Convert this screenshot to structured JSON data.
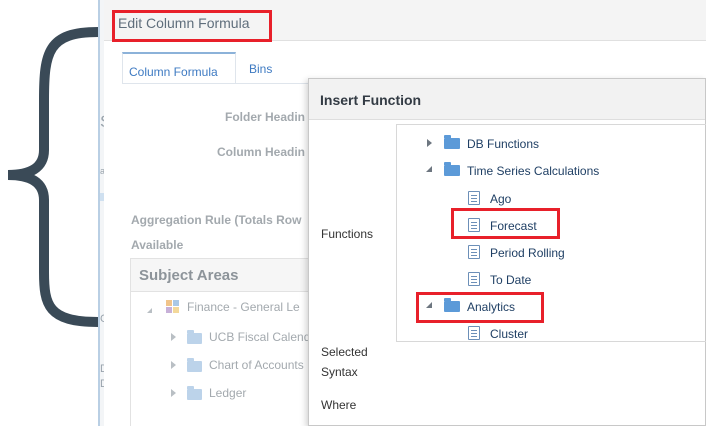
{
  "dialog": {
    "title": "Edit Column Formula",
    "tabs": [
      {
        "label": "Column Formula"
      },
      {
        "label": "Bins"
      }
    ],
    "labels": {
      "folder_heading": "Folder Headin",
      "column_heading": "Column Headin",
      "aggregation_rule": "Aggregation Rule (Totals Row",
      "available": "Available"
    },
    "subject_areas": {
      "header": "Subject Areas",
      "items": [
        {
          "label": "Finance - General Le"
        },
        {
          "label": "UCB Fiscal Calend"
        },
        {
          "label": "Chart of Accounts"
        },
        {
          "label": "Ledger"
        }
      ]
    },
    "bg_chars": [
      "S",
      "ac",
      "C",
      "D",
      "D"
    ]
  },
  "insert_function": {
    "title": "Insert Function",
    "labels": {
      "functions": "Functions",
      "selected": "Selected",
      "syntax": "Syntax",
      "where": "Where"
    },
    "tree": [
      {
        "label": "DB Functions",
        "kind": "folder",
        "state": "collapsed"
      },
      {
        "label": "Time Series Calculations",
        "kind": "folder",
        "state": "expanded"
      },
      {
        "label": "Ago",
        "kind": "function"
      },
      {
        "label": "Forecast",
        "kind": "function",
        "highlighted": true
      },
      {
        "label": "Period Rolling",
        "kind": "function"
      },
      {
        "label": "To Date",
        "kind": "function"
      },
      {
        "label": "Analytics",
        "kind": "folder",
        "state": "expanded",
        "highlighted": true
      },
      {
        "label": "Cluster",
        "kind": "function"
      }
    ]
  },
  "colors": {
    "highlight": "#e8202a",
    "brace": "#3a4a57",
    "folder": "#5c9ad8",
    "link_text": "#1f3f64"
  }
}
